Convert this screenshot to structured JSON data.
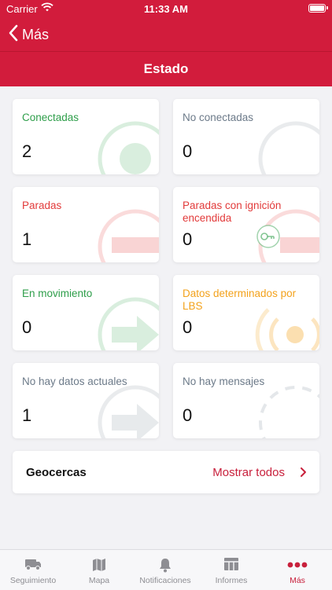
{
  "status_bar": {
    "carrier": "Carrier",
    "time": "11:33 AM"
  },
  "nav": {
    "back_label": "Más"
  },
  "page": {
    "title": "Estado"
  },
  "colors": {
    "brand": "#d21c3c",
    "green": "#2e9e4a",
    "red": "#e23a3a",
    "orange": "#f3a21c",
    "gray": "#6c7a89"
  },
  "cards": [
    {
      "label": "Conectadas",
      "count": "2",
      "color": "green",
      "icon": "connected-icon"
    },
    {
      "label": "No conectadas",
      "count": "0",
      "color": "gray",
      "icon": "disconnected-icon"
    },
    {
      "label": "Paradas",
      "count": "1",
      "color": "red",
      "icon": "stopped-icon"
    },
    {
      "label": "Paradas con ignición encendida",
      "count": "0",
      "color": "red",
      "icon": "ignition-key-icon"
    },
    {
      "label": "En movimiento",
      "count": "0",
      "color": "green",
      "icon": "moving-arrow-icon"
    },
    {
      "label": "Datos determinados por LBS",
      "count": "0",
      "color": "orange",
      "icon": "lbs-signal-icon"
    },
    {
      "label": "No hay datos actuales",
      "count": "1",
      "color": "gray",
      "icon": "no-data-arrow-icon"
    },
    {
      "label": "No hay mensajes",
      "count": "0",
      "color": "gray",
      "icon": "no-messages-dashed-icon"
    }
  ],
  "geofences": {
    "title": "Geocercas",
    "link": "Mostrar todos"
  },
  "tabs": [
    {
      "label": "Seguimiento",
      "icon": "truck-icon",
      "active": false
    },
    {
      "label": "Mapa",
      "icon": "map-icon",
      "active": false
    },
    {
      "label": "Notificaciones",
      "icon": "bell-icon",
      "active": false
    },
    {
      "label": "Informes",
      "icon": "reports-table-icon",
      "active": false
    },
    {
      "label": "Más",
      "icon": "more-dots-icon",
      "active": true
    }
  ]
}
